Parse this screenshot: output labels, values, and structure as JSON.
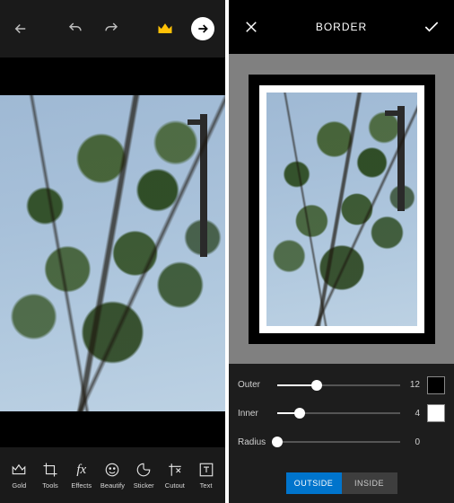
{
  "left": {
    "tools": [
      {
        "label": "Gold"
      },
      {
        "label": "Tools"
      },
      {
        "label": "Effects"
      },
      {
        "label": "Beautify"
      },
      {
        "label": "Sticker"
      },
      {
        "label": "Cutout"
      },
      {
        "label": "Text"
      }
    ]
  },
  "right": {
    "title": "BORDER",
    "sliders": {
      "outer": {
        "label": "Outer",
        "value": "12",
        "pct": 32,
        "swatch": "#000000"
      },
      "inner": {
        "label": "Inner",
        "value": "4",
        "pct": 18,
        "swatch": "#ffffff"
      },
      "radius": {
        "label": "Radius",
        "value": "0",
        "pct": 0
      }
    },
    "tabs": {
      "outside": "OUTSIDE",
      "inside": "INSIDE",
      "active": "outside"
    }
  }
}
